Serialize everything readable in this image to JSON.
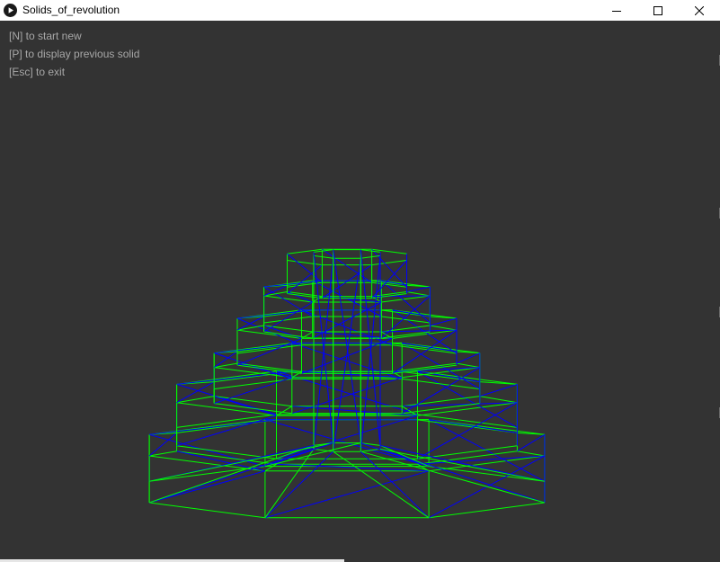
{
  "window": {
    "title": "Solids_of_revolution",
    "controls": [
      "minimize",
      "maximize",
      "close"
    ]
  },
  "help_lines": [
    "[N] to start new",
    "[P] to display previous solid",
    "[Esc] to exit"
  ],
  "scene": {
    "background": "#333333",
    "wire_colors": {
      "outline": "#00ff00",
      "diagonal": "#0000ff"
    },
    "solid": "stepped solid of revolution rendered as octagonal wireframe"
  }
}
